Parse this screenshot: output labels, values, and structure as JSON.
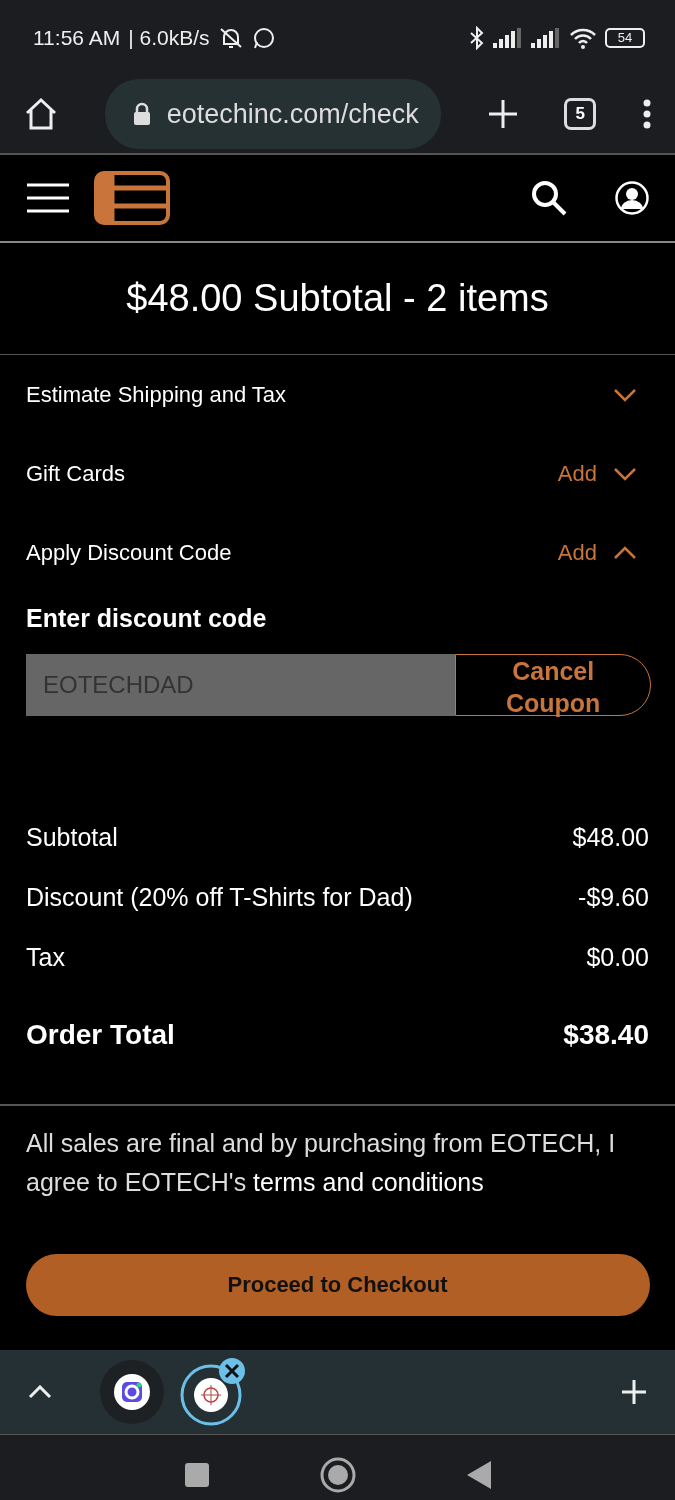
{
  "status_bar": {
    "time": "11:56 AM",
    "speed": "| 6.0kB/s",
    "battery": "54"
  },
  "browser": {
    "url": "eotechinc.com/check",
    "tab_count": "5"
  },
  "subtotal_header": "$48.00 Subtotal - 2 items",
  "sections": [
    {
      "label": "Estimate Shipping and Tax",
      "expanded": false
    },
    {
      "label": "Gift Cards",
      "action": "Add",
      "expanded": false
    },
    {
      "label": "Apply Discount Code",
      "action": "Add",
      "expanded": true
    }
  ],
  "discount": {
    "heading": "Enter discount code",
    "value": "EOTECHDAD",
    "disabled": true,
    "button": "Cancel Coupon"
  },
  "totals": [
    {
      "label": "Subtotal",
      "amount": "$48.00",
      "bold": false
    },
    {
      "label": "Discount (20% off T-Shirts for Dad)",
      "amount": "-$9.60",
      "bold": false
    },
    {
      "label": "Tax",
      "amount": "$0.00",
      "bold": false
    },
    {
      "label": "Order Total",
      "amount": "$38.40",
      "bold": true
    }
  ],
  "terms": {
    "text": "All sales are final and by purchasing from EOTECH, I agree to EOTECH's",
    "link": "terms and conditions"
  },
  "checkout_button": "Proceed to Checkout"
}
